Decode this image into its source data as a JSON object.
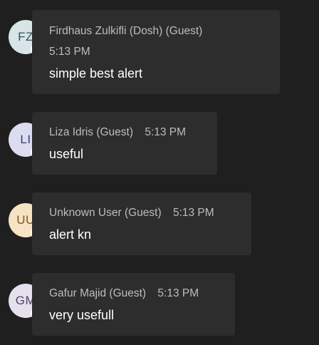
{
  "messages": [
    {
      "initials": "FZ",
      "avatar_bg": "#d8e4e6",
      "avatar_fg": "#33535a",
      "sender": "Firdhaus Zulkifli (Dosh) (Guest)",
      "time": "5:13 PM",
      "text": "simple best alert"
    },
    {
      "initials": "LI",
      "avatar_bg": "#dcdcf0",
      "avatar_fg": "#3b3b7a",
      "sender": "Liza Idris (Guest)",
      "time": "5:13 PM",
      "text": "useful"
    },
    {
      "initials": "UU",
      "avatar_bg": "#f6e3c4",
      "avatar_fg": "#7a5520",
      "sender": "Unknown User (Guest)",
      "time": "5:13 PM",
      "text": "alert kn"
    },
    {
      "initials": "GM",
      "avatar_bg": "#e4e0ee",
      "avatar_fg": "#4e4766",
      "sender": "Gafur Majid (Guest)",
      "time": "5:13 PM",
      "text": "very usefull"
    }
  ]
}
